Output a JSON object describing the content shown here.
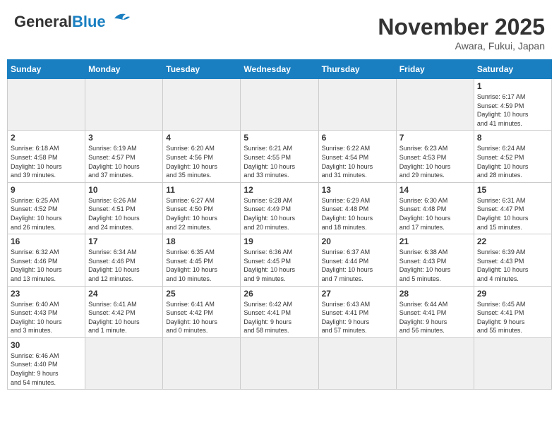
{
  "header": {
    "logo_general": "General",
    "logo_blue": "Blue",
    "month_title": "November 2025",
    "location": "Awara, Fukui, Japan"
  },
  "days_of_week": [
    "Sunday",
    "Monday",
    "Tuesday",
    "Wednesday",
    "Thursday",
    "Friday",
    "Saturday"
  ],
  "weeks": [
    [
      {
        "day": "",
        "info": ""
      },
      {
        "day": "",
        "info": ""
      },
      {
        "day": "",
        "info": ""
      },
      {
        "day": "",
        "info": ""
      },
      {
        "day": "",
        "info": ""
      },
      {
        "day": "",
        "info": ""
      },
      {
        "day": "1",
        "info": "Sunrise: 6:17 AM\nSunset: 4:59 PM\nDaylight: 10 hours\nand 41 minutes."
      }
    ],
    [
      {
        "day": "2",
        "info": "Sunrise: 6:18 AM\nSunset: 4:58 PM\nDaylight: 10 hours\nand 39 minutes."
      },
      {
        "day": "3",
        "info": "Sunrise: 6:19 AM\nSunset: 4:57 PM\nDaylight: 10 hours\nand 37 minutes."
      },
      {
        "day": "4",
        "info": "Sunrise: 6:20 AM\nSunset: 4:56 PM\nDaylight: 10 hours\nand 35 minutes."
      },
      {
        "day": "5",
        "info": "Sunrise: 6:21 AM\nSunset: 4:55 PM\nDaylight: 10 hours\nand 33 minutes."
      },
      {
        "day": "6",
        "info": "Sunrise: 6:22 AM\nSunset: 4:54 PM\nDaylight: 10 hours\nand 31 minutes."
      },
      {
        "day": "7",
        "info": "Sunrise: 6:23 AM\nSunset: 4:53 PM\nDaylight: 10 hours\nand 29 minutes."
      },
      {
        "day": "8",
        "info": "Sunrise: 6:24 AM\nSunset: 4:52 PM\nDaylight: 10 hours\nand 28 minutes."
      }
    ],
    [
      {
        "day": "9",
        "info": "Sunrise: 6:25 AM\nSunset: 4:52 PM\nDaylight: 10 hours\nand 26 minutes."
      },
      {
        "day": "10",
        "info": "Sunrise: 6:26 AM\nSunset: 4:51 PM\nDaylight: 10 hours\nand 24 minutes."
      },
      {
        "day": "11",
        "info": "Sunrise: 6:27 AM\nSunset: 4:50 PM\nDaylight: 10 hours\nand 22 minutes."
      },
      {
        "day": "12",
        "info": "Sunrise: 6:28 AM\nSunset: 4:49 PM\nDaylight: 10 hours\nand 20 minutes."
      },
      {
        "day": "13",
        "info": "Sunrise: 6:29 AM\nSunset: 4:48 PM\nDaylight: 10 hours\nand 18 minutes."
      },
      {
        "day": "14",
        "info": "Sunrise: 6:30 AM\nSunset: 4:48 PM\nDaylight: 10 hours\nand 17 minutes."
      },
      {
        "day": "15",
        "info": "Sunrise: 6:31 AM\nSunset: 4:47 PM\nDaylight: 10 hours\nand 15 minutes."
      }
    ],
    [
      {
        "day": "16",
        "info": "Sunrise: 6:32 AM\nSunset: 4:46 PM\nDaylight: 10 hours\nand 13 minutes."
      },
      {
        "day": "17",
        "info": "Sunrise: 6:34 AM\nSunset: 4:46 PM\nDaylight: 10 hours\nand 12 minutes."
      },
      {
        "day": "18",
        "info": "Sunrise: 6:35 AM\nSunset: 4:45 PM\nDaylight: 10 hours\nand 10 minutes."
      },
      {
        "day": "19",
        "info": "Sunrise: 6:36 AM\nSunset: 4:45 PM\nDaylight: 10 hours\nand 9 minutes."
      },
      {
        "day": "20",
        "info": "Sunrise: 6:37 AM\nSunset: 4:44 PM\nDaylight: 10 hours\nand 7 minutes."
      },
      {
        "day": "21",
        "info": "Sunrise: 6:38 AM\nSunset: 4:43 PM\nDaylight: 10 hours\nand 5 minutes."
      },
      {
        "day": "22",
        "info": "Sunrise: 6:39 AM\nSunset: 4:43 PM\nDaylight: 10 hours\nand 4 minutes."
      }
    ],
    [
      {
        "day": "23",
        "info": "Sunrise: 6:40 AM\nSunset: 4:43 PM\nDaylight: 10 hours\nand 3 minutes."
      },
      {
        "day": "24",
        "info": "Sunrise: 6:41 AM\nSunset: 4:42 PM\nDaylight: 10 hours\nand 1 minute."
      },
      {
        "day": "25",
        "info": "Sunrise: 6:41 AM\nSunset: 4:42 PM\nDaylight: 10 hours\nand 0 minutes."
      },
      {
        "day": "26",
        "info": "Sunrise: 6:42 AM\nSunset: 4:41 PM\nDaylight: 9 hours\nand 58 minutes."
      },
      {
        "day": "27",
        "info": "Sunrise: 6:43 AM\nSunset: 4:41 PM\nDaylight: 9 hours\nand 57 minutes."
      },
      {
        "day": "28",
        "info": "Sunrise: 6:44 AM\nSunset: 4:41 PM\nDaylight: 9 hours\nand 56 minutes."
      },
      {
        "day": "29",
        "info": "Sunrise: 6:45 AM\nSunset: 4:41 PM\nDaylight: 9 hours\nand 55 minutes."
      }
    ],
    [
      {
        "day": "30",
        "info": "Sunrise: 6:46 AM\nSunset: 4:40 PM\nDaylight: 9 hours\nand 54 minutes."
      },
      {
        "day": "",
        "info": ""
      },
      {
        "day": "",
        "info": ""
      },
      {
        "day": "",
        "info": ""
      },
      {
        "day": "",
        "info": ""
      },
      {
        "day": "",
        "info": ""
      },
      {
        "day": "",
        "info": ""
      }
    ]
  ]
}
